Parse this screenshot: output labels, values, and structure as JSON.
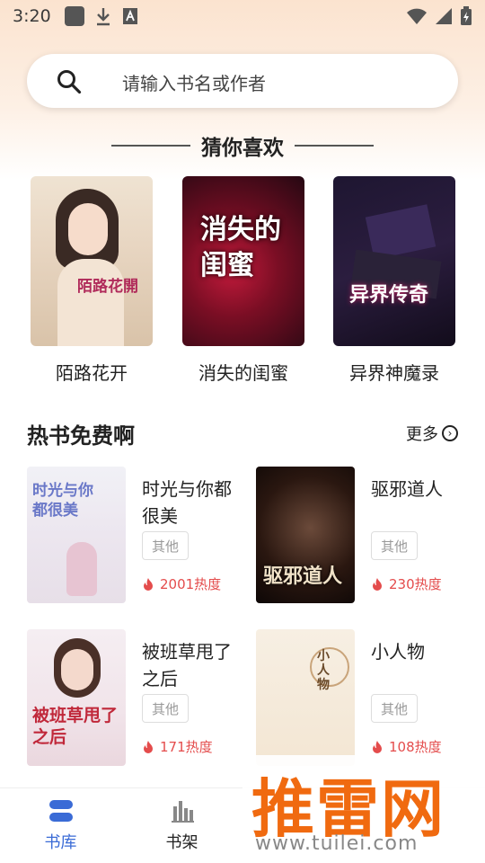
{
  "status_bar": {
    "time": "3:20"
  },
  "search": {
    "placeholder": "请输入书名或作者"
  },
  "guess_section": {
    "title": "猜你喜欢"
  },
  "featured": [
    {
      "title": "陌路花开",
      "cover_text": "陌路花開"
    },
    {
      "title": "消失的闺蜜",
      "cover_text": "消失的闺蜜"
    },
    {
      "title": "异界神魔录",
      "cover_text": "异界传奇"
    }
  ],
  "hot_section": {
    "title": "热书免费啊",
    "more_label": "更多"
  },
  "hot_books": [
    {
      "title": "时光与你都很美",
      "tag": "其他",
      "heat": "2001热度",
      "cover_text": "时光与你都很美"
    },
    {
      "title": "驱邪道人",
      "tag": "其他",
      "heat": "230热度",
      "cover_text": "驱邪道人"
    },
    {
      "title": "被班草甩了之后",
      "tag": "其他",
      "heat": "171热度",
      "cover_text": "被班草甩了之后"
    },
    {
      "title": "小人物",
      "tag": "其他",
      "heat": "108热度",
      "cover_text": "小人物"
    }
  ],
  "bottom_nav": {
    "items": [
      {
        "label": "书库",
        "icon": "library-icon",
        "active": true
      },
      {
        "label": "书架",
        "icon": "bookshelf-icon",
        "active": false
      }
    ]
  },
  "watermark": {
    "main": "推雷网",
    "sub": "www.tuilei.com"
  },
  "colors": {
    "accent": "#3a6bd6",
    "heat": "#e44c4c",
    "watermark": "#f06a10"
  }
}
